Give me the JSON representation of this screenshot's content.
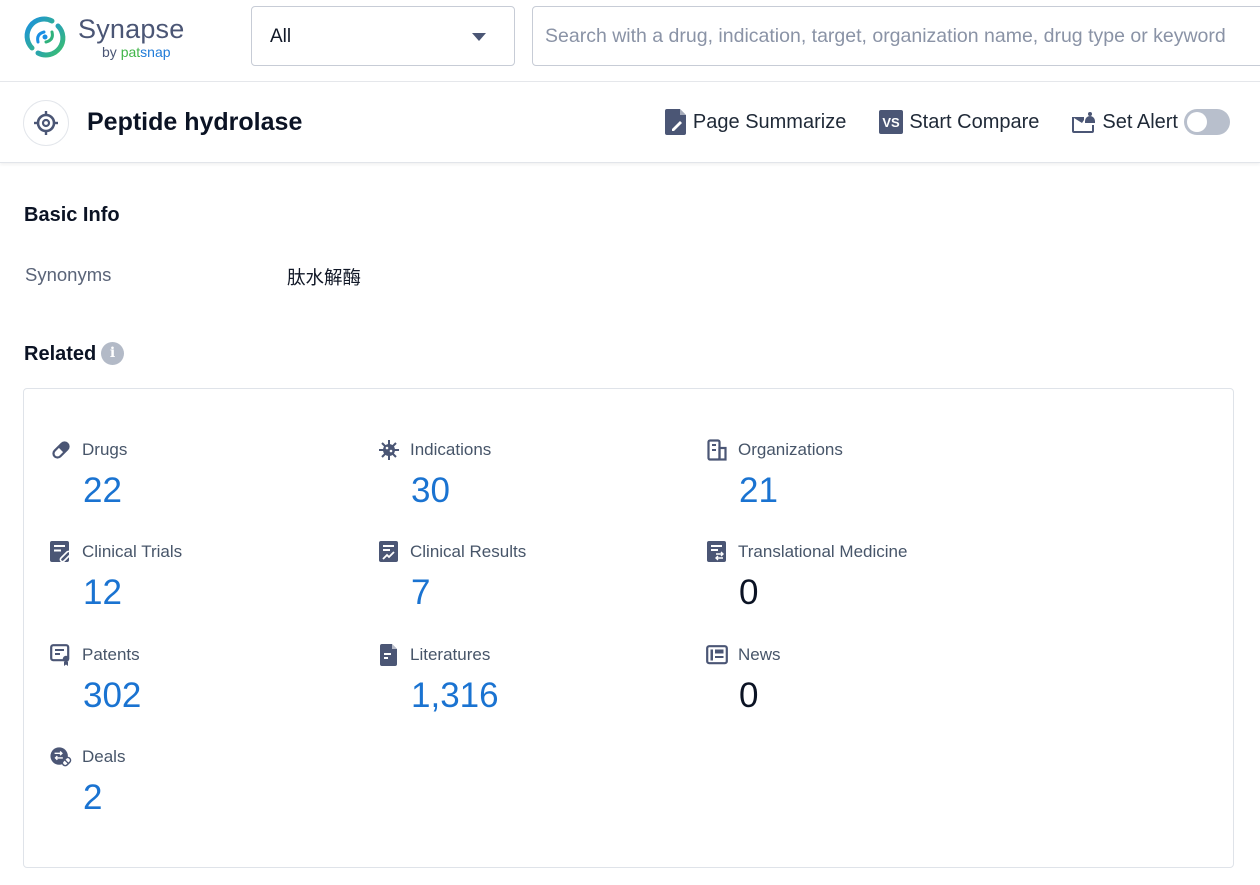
{
  "app": {
    "name": "Synapse",
    "byline_prefix": "by ",
    "byline_pat": "pat",
    "byline_snap": "snap"
  },
  "search": {
    "scope_selected": "All",
    "placeholder": "Search with a drug, indication, target, organization name, drug type or keyword",
    "value": ""
  },
  "header": {
    "title": "Peptide hydrolase",
    "icon": "target-icon",
    "actions": {
      "summarize": "Page Summarize",
      "compare": "Start Compare",
      "alert": "Set Alert"
    },
    "alert_enabled": false
  },
  "basic_info": {
    "title": "Basic Info",
    "synonyms_label": "Synonyms",
    "synonyms_value": "肽水解酶"
  },
  "related": {
    "title": "Related",
    "info_icon": "i",
    "items": [
      {
        "label": "Drugs",
        "value": "22",
        "icon": "pill-icon"
      },
      {
        "label": "Indications",
        "value": "30",
        "icon": "virus-icon"
      },
      {
        "label": "Organizations",
        "value": "21",
        "icon": "building-icon"
      },
      {
        "label": "Clinical Trials",
        "value": "12",
        "icon": "clinical-trials-icon"
      },
      {
        "label": "Clinical Results",
        "value": "7",
        "icon": "clinical-results-icon"
      },
      {
        "label": "Translational Medicine",
        "value": "0",
        "icon": "translational-medicine-icon"
      },
      {
        "label": "Patents",
        "value": "302",
        "icon": "patent-icon"
      },
      {
        "label": "Literatures",
        "value": "1,316",
        "icon": "document-icon"
      },
      {
        "label": "News",
        "value": "0",
        "icon": "newspaper-icon"
      },
      {
        "label": "Deals",
        "value": "2",
        "icon": "deals-icon"
      }
    ]
  },
  "colors": {
    "accent": "#1a73d1",
    "icon": "#4b5675",
    "zero_value": "#0b1324"
  }
}
